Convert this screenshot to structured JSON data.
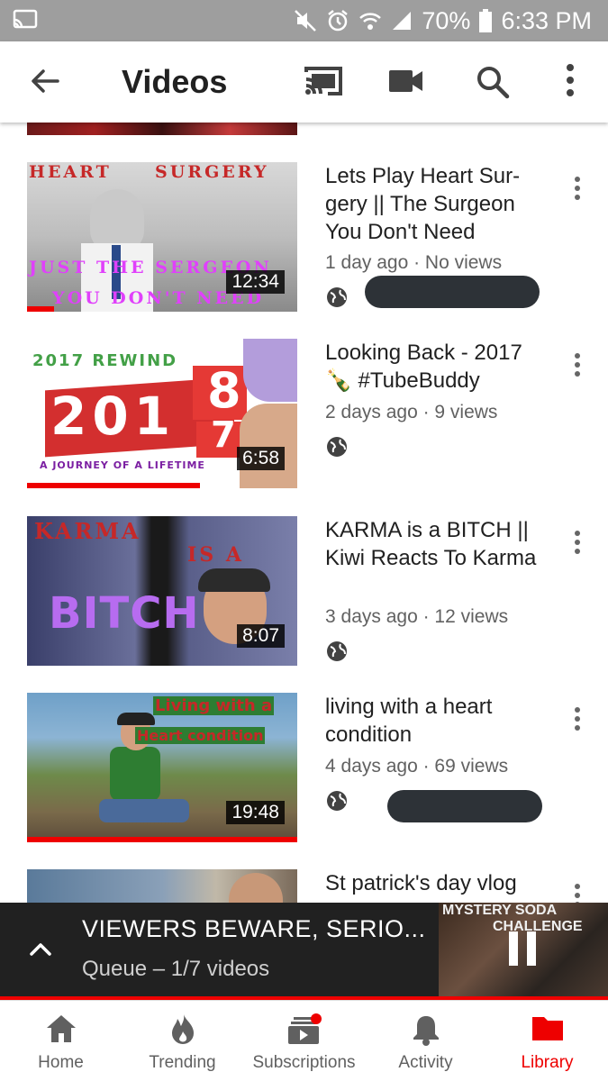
{
  "status_bar": {
    "battery": "70%",
    "time": "6:33 PM"
  },
  "app_bar": {
    "title": "Videos"
  },
  "videos": [
    {
      "title": "Lets Play Heart Sur-gery || The Surgeon You Don't Need",
      "meta": "1 day ago · No views",
      "duration": "12:34",
      "thumb_text_top_left": "HEART",
      "thumb_text_top_right": "SURGERY",
      "thumb_text_bottom_1": "JUST THE SERGEON",
      "thumb_text_bottom_2": "YOU DON'T NEED",
      "watched_fraction": 0.1
    },
    {
      "title": "Looking Back - 2017 🍾 #TubeBuddy",
      "meta": "2 days ago · 9 views",
      "duration": "6:58",
      "thumb_text_top": "2017 REWIND",
      "thumb_text_big": "201",
      "thumb_text_cube_1": "8",
      "thumb_text_cube_2": "7",
      "thumb_text_bottom": "A JOURNEY OF A LIFETIME",
      "watched_fraction": 0.64
    },
    {
      "title": "KARMA is a BITCH || Kiwi Reacts To Karma",
      "meta": "3 days ago · 12 views",
      "duration": "8:07",
      "thumb_text_1": "KARMA",
      "thumb_text_2": "IS A",
      "thumb_text_3": "BITCH",
      "watched_fraction": 0
    },
    {
      "title": "living with a heart condition",
      "meta": "4 days ago · 69 views",
      "duration": "19:48",
      "thumb_text_1": "Living with a",
      "thumb_text_2": "Heart condition",
      "watched_fraction": 1.0
    },
    {
      "title": "St patrick's day vlog"
    }
  ],
  "mini_player": {
    "title": "VIEWERS BEWARE, SERIO...",
    "queue": "Queue – 1/7 videos",
    "thumb_text_1": "MYSTERY SODA",
    "thumb_text_2": "CHALLENGE"
  },
  "bottom_nav": [
    {
      "label": "Home",
      "icon": "home-icon"
    },
    {
      "label": "Trending",
      "icon": "fire-icon"
    },
    {
      "label": "Subscriptions",
      "icon": "subscriptions-icon"
    },
    {
      "label": "Activity",
      "icon": "bell-icon"
    },
    {
      "label": "Library",
      "icon": "folder-icon",
      "active": true
    }
  ],
  "colors": {
    "accent": "#ee0000",
    "status_bar": "#9e9e9e",
    "mini_player_bg": "#212121"
  }
}
